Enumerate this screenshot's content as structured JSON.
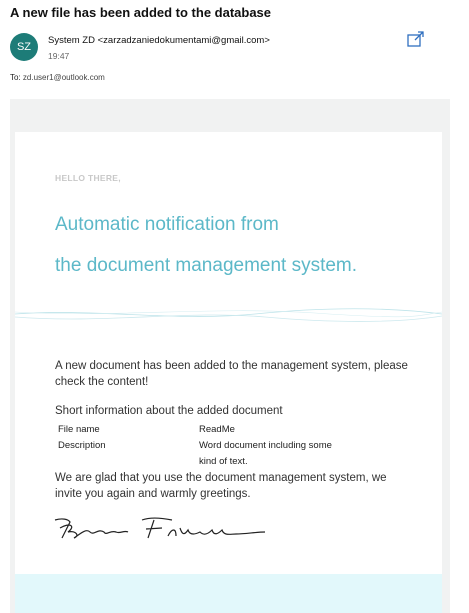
{
  "email": {
    "subject": "A new file has been added to the database",
    "avatar_initials": "SZ",
    "sender": "System ZD <zarzadzaniedokumentami@gmail.com>",
    "time": "19:47",
    "to_label": "To:",
    "to_value": "zd.user1@outlook.com"
  },
  "body": {
    "greeting": "HELLO THERE,",
    "headline_line1": "Automatic notification from",
    "headline_line2": "the document management system.",
    "paragraph1": "A new document has been added to the management system, please check the content!",
    "short_info_title": "Short information about the added document",
    "info_rows": [
      {
        "key": "File name",
        "value": "ReadMe"
      },
      {
        "key": "Description",
        "value": "Word document including some kind of text."
      }
    ],
    "paragraph2": "We are glad that you use the document management system, we invite you again and warmly greetings."
  },
  "colors": {
    "avatar": "#1d7c78",
    "headline": "#5cb8c8",
    "footer_band": "#e2f8fb",
    "outer_bg": "#f1f2f2"
  },
  "icons": {
    "popout": "open-in-new-window-icon"
  }
}
